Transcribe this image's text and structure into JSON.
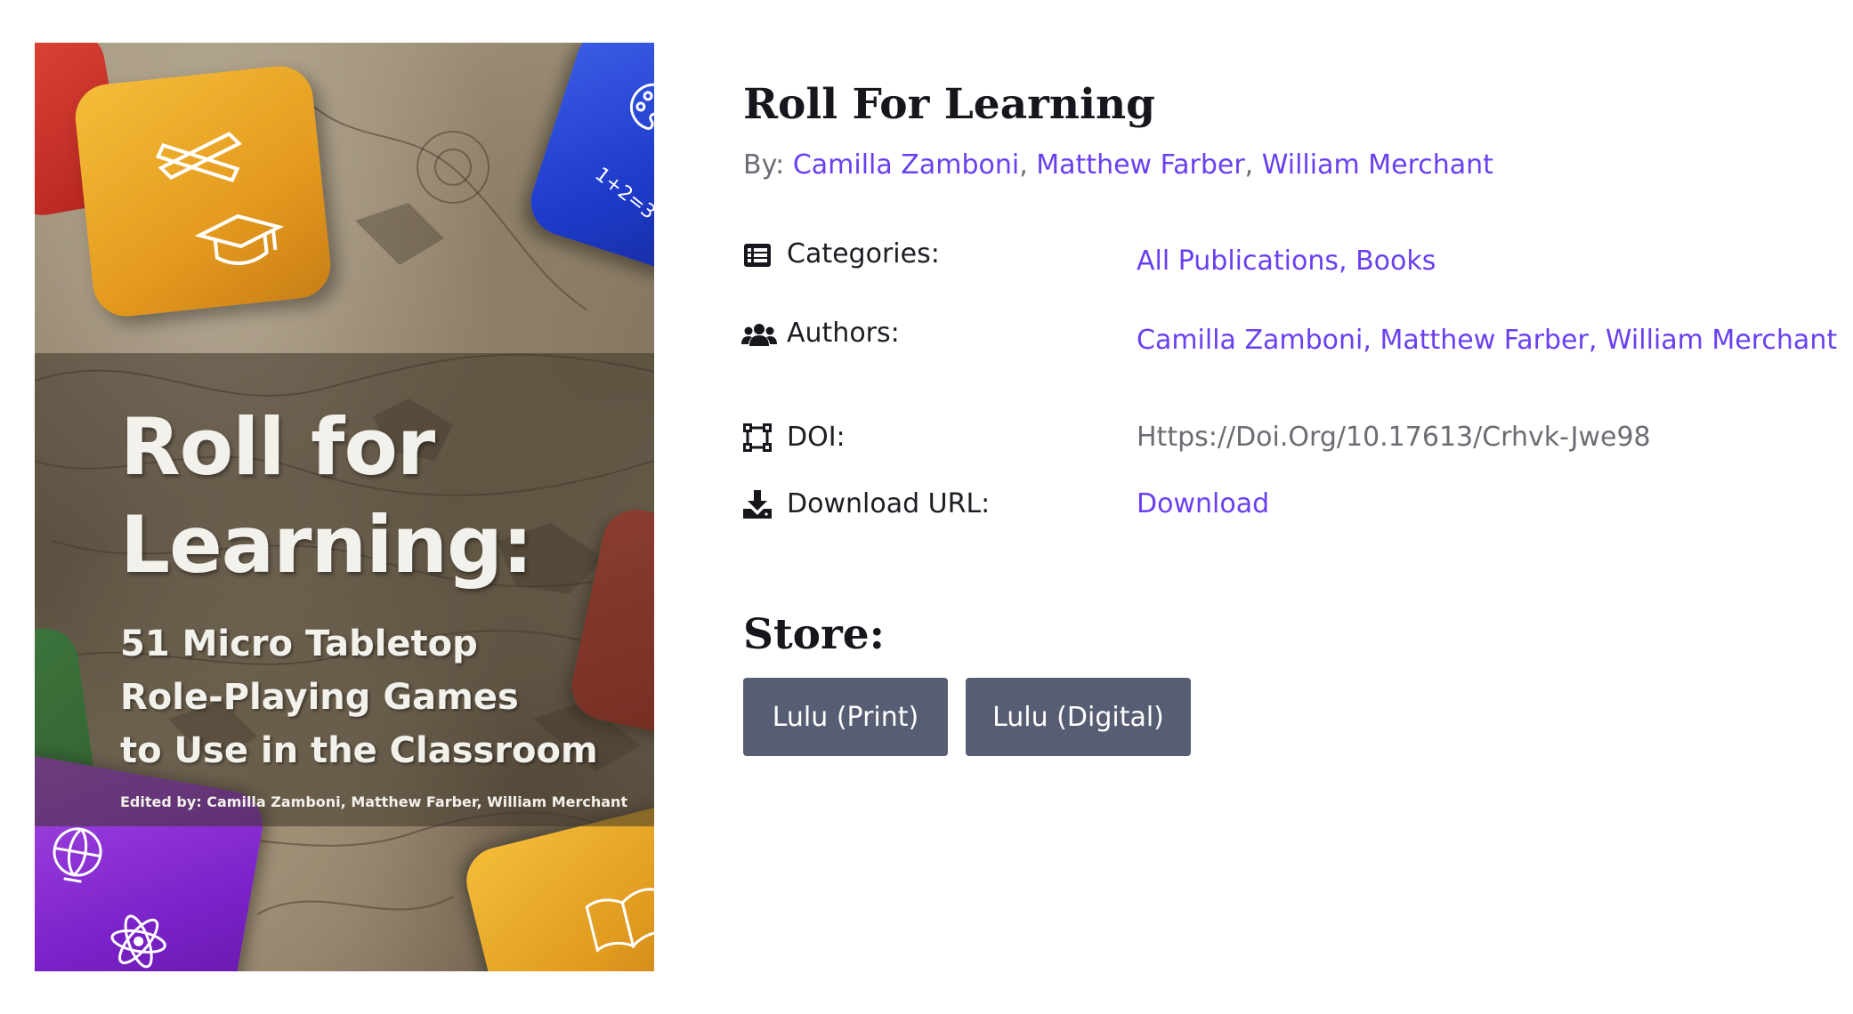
{
  "book": {
    "title": "Roll For Learning",
    "by_label": "By:",
    "authors": [
      "Camilla Zamboni",
      "Matthew Farber",
      "William Merchant"
    ]
  },
  "cover": {
    "title_line1": "Roll for",
    "title_line2": "Learning:",
    "subtitle_line1": "51 Micro Tabletop",
    "subtitle_line2": "Role-Playing Games",
    "subtitle_line3": "to Use in the Classroom",
    "editors": "Edited by: Camilla Zamboni, Matthew Farber, William Merchant"
  },
  "meta": {
    "categories": {
      "label": "Categories:",
      "icon": "list-icon",
      "value": "All Publications, Books"
    },
    "authors": {
      "label": "Authors:",
      "icon": "users-icon",
      "value": "Camilla Zamboni, Matthew Farber, William Merchant"
    },
    "doi": {
      "label": "DOI:",
      "icon": "vector-square-icon",
      "value": "Https://Doi.Org/10.17613/Crhvk-Jwe98"
    },
    "download": {
      "label": "Download URL:",
      "icon": "download-icon",
      "value": "Download"
    }
  },
  "store": {
    "heading": "Store:",
    "buttons": [
      {
        "label": "Lulu (Print)"
      },
      {
        "label": "Lulu (Digital)"
      }
    ]
  },
  "colors": {
    "link": "#6a3ff0",
    "muted_text": "#6c6c74",
    "heading": "#16161d",
    "button_bg": "#575e74"
  }
}
